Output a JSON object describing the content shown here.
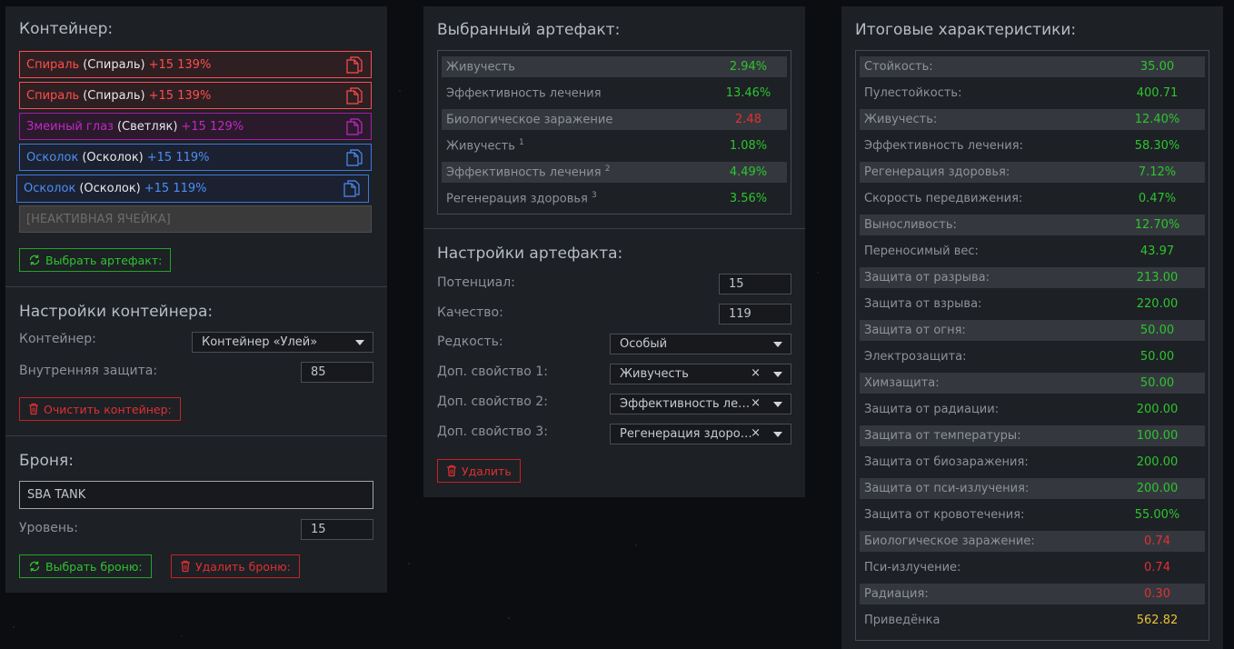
{
  "container": {
    "title": "Контейнер:",
    "slots": [
      {
        "name": "Спираль",
        "sub": "(Спираль)",
        "pct": "+15 139%",
        "color": "#ff4d4d"
      },
      {
        "name": "Спираль",
        "sub": "(Спираль)",
        "pct": "+15 139%",
        "color": "#ff4d4d"
      },
      {
        "name": "Змеиный глаз",
        "sub": "(Светляк)",
        "pct": "+15 129%",
        "color": "#c228c2"
      },
      {
        "name": "Осколок",
        "sub": "(Осколок)",
        "pct": "+15 119%",
        "color": "#4d8df5"
      },
      {
        "name": "Осколок",
        "sub": "(Осколок)",
        "pct": "+15 119%",
        "color": "#4d8df5"
      }
    ],
    "inactive": "[НЕАКТИВНАЯ ЯЧЕЙКА]",
    "select_btn": "Выбрать артефакт:"
  },
  "container_settings": {
    "title": "Настройки контейнера:",
    "container_label": "Контейнер:",
    "container_value": "Контейнер «Улей»",
    "protection_label": "Внутренняя защита:",
    "protection_value": "85",
    "clear_btn": "Очистить контейнер:"
  },
  "armor": {
    "title": "Броня:",
    "name": "SBA TANK",
    "level_label": "Уровень:",
    "level_value": "15",
    "select_btn": "Выбрать броню:",
    "delete_btn": "Удалить броню:"
  },
  "artifact": {
    "title": "Выбранный артефакт:",
    "stats": [
      {
        "k": "Живучесть",
        "sup": "",
        "v": "2.94%",
        "c": "g"
      },
      {
        "k": "Эффективность лечения",
        "sup": "",
        "v": "13.46%",
        "c": "g"
      },
      {
        "k": "Биологическое заражение",
        "sup": "",
        "v": "2.48",
        "c": "r"
      },
      {
        "k": "Живучесть",
        "sup": "1",
        "v": "1.08%",
        "c": "g"
      },
      {
        "k": "Эффективность лечения",
        "sup": "2",
        "v": "4.49%",
        "c": "g"
      },
      {
        "k": "Регенерация здоровья",
        "sup": "3",
        "v": "3.56%",
        "c": "g"
      }
    ]
  },
  "artifact_settings": {
    "title": "Настройки артефакта:",
    "potential_label": "Потенциал:",
    "potential_value": "15",
    "quality_label": "Качество:",
    "quality_value": "119",
    "rarity_label": "Редкость:",
    "rarity_value": "Особый",
    "prop1_label": "Доп. свойство 1:",
    "prop1_value": "Живучесть",
    "prop2_label": "Доп. свойство 2:",
    "prop2_value": "Эффективность лечения",
    "prop3_label": "Доп. свойство 3:",
    "prop3_value": "Регенерация здоровья",
    "delete_btn": "Удалить"
  },
  "totals": {
    "title": "Итоговые характеристики:",
    "stats": [
      {
        "k": "Стойкость:",
        "v": "35.00",
        "c": "g"
      },
      {
        "k": "Пулестойкость:",
        "v": "400.71",
        "c": "g"
      },
      {
        "k": "Живучесть:",
        "v": "12.40%",
        "c": "g"
      },
      {
        "k": "Эффективность лечения:",
        "v": "58.30%",
        "c": "g"
      },
      {
        "k": "Регенерация здоровья:",
        "v": "7.12%",
        "c": "g"
      },
      {
        "k": "Скорость передвижения:",
        "v": "0.47%",
        "c": "g"
      },
      {
        "k": "Выносливость:",
        "v": "12.70%",
        "c": "g"
      },
      {
        "k": "Переносимый вес:",
        "v": "43.97",
        "c": "g"
      },
      {
        "k": "Защита от разрыва:",
        "v": "213.00",
        "c": "g"
      },
      {
        "k": "Защита от взрыва:",
        "v": "220.00",
        "c": "g"
      },
      {
        "k": "Защита от огня:",
        "v": "50.00",
        "c": "g"
      },
      {
        "k": "Электрозащита:",
        "v": "50.00",
        "c": "g"
      },
      {
        "k": "Химзащита:",
        "v": "50.00",
        "c": "g"
      },
      {
        "k": "Защита от радиации:",
        "v": "200.00",
        "c": "g"
      },
      {
        "k": "Защита от температуры:",
        "v": "100.00",
        "c": "g"
      },
      {
        "k": "Защита от биозаражения:",
        "v": "200.00",
        "c": "g"
      },
      {
        "k": "Защита от пси-излучения:",
        "v": "200.00",
        "c": "g"
      },
      {
        "k": "Защита от кровотечения:",
        "v": "55.00%",
        "c": "g"
      },
      {
        "k": "Биологическое заражение:",
        "v": "0.74",
        "c": "r"
      },
      {
        "k": "Пси-излучение:",
        "v": "0.74",
        "c": "r"
      },
      {
        "k": "Радиация:",
        "v": "0.30",
        "c": "r"
      },
      {
        "k": "Приведёнка",
        "v": "562.82",
        "c": "y"
      }
    ]
  }
}
